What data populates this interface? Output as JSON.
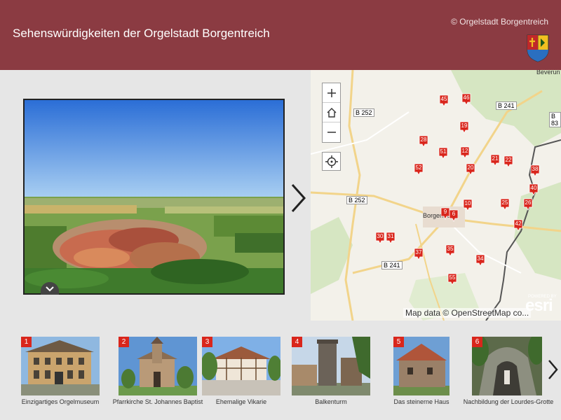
{
  "header": {
    "title": "Sehenswürdigkeiten der Orgelstadt Borgentreich",
    "copyright": "© Orgelstadt Borgentreich",
    "bg_color": "#8b3b42"
  },
  "map": {
    "attribution": "Map data © OpenStreetMap co...",
    "esri_powered": "POWERED BY",
    "esri_logo": "esri",
    "labels": {
      "town_beverungen": "Beverun",
      "town_borgentreich": "Borgentreich",
      "road_b252_a": "B 252",
      "road_b252_b": "B 252",
      "road_b241_a": "B 241",
      "road_b241_b": "B 241",
      "road_b83": "B 83"
    },
    "markers": [
      "45",
      "46",
      "19",
      "28",
      "51",
      "12",
      "21",
      "22",
      "52",
      "20",
      "38",
      "40",
      "10",
      "25",
      "26",
      "9",
      "6",
      "42",
      "30",
      "31",
      "37",
      "35",
      "34",
      "55"
    ],
    "marker_color": "#d9261c"
  },
  "thumbnails": [
    {
      "num": "1",
      "caption": "Einzigartiges Orgelmuseum"
    },
    {
      "num": "2",
      "caption": "Pfarrkirche St. Johannes Baptist"
    },
    {
      "num": "3",
      "caption": "Ehemalige Vikarie"
    },
    {
      "num": "4",
      "caption": "Balkenturm"
    },
    {
      "num": "5",
      "caption": "Das steinerne Haus"
    },
    {
      "num": "6",
      "caption": "Nachbildung der Lourdes-Grotte"
    }
  ],
  "icons": {
    "zoom_in": "plus-icon",
    "home": "home-icon",
    "zoom_out": "minus-icon",
    "locate": "locate-icon",
    "next": "chevron-right-icon",
    "expand": "chevron-down-icon"
  }
}
